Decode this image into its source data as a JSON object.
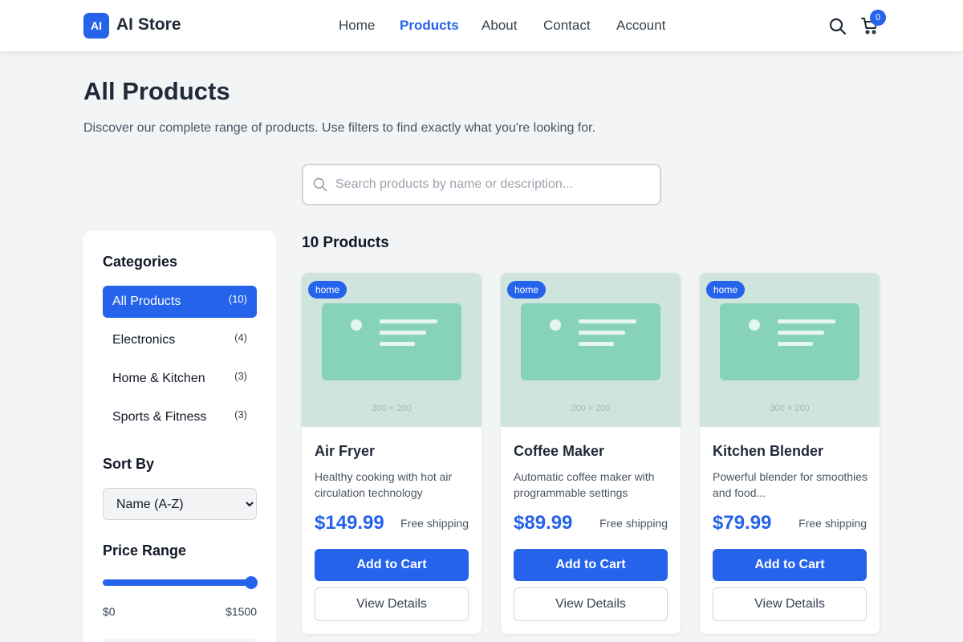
{
  "brand": {
    "logo_mark": "AI",
    "name": "AI Store"
  },
  "nav": {
    "items": [
      {
        "label": "Home",
        "active": false
      },
      {
        "label": "Products",
        "active": true
      },
      {
        "label": "About",
        "active": false
      },
      {
        "label": "Contact",
        "active": false
      },
      {
        "label": "Account",
        "active": false
      }
    ]
  },
  "header_icons": {
    "search": "search-icon",
    "cart": "cart-icon",
    "cart_count": "0"
  },
  "page": {
    "title": "All Products",
    "subtitle": "Discover our complete range of products. Use filters to find exactly what you're looking for."
  },
  "search": {
    "placeholder": "Search products by name or description...",
    "value": ""
  },
  "sidebar": {
    "categories_heading": "Categories",
    "categories": [
      {
        "label": "All Products",
        "count": "(10)",
        "active": true
      },
      {
        "label": "Electronics",
        "count": "(4)",
        "active": false
      },
      {
        "label": "Home & Kitchen",
        "count": "(3)",
        "active": false
      },
      {
        "label": "Sports & Fitness",
        "count": "(3)",
        "active": false
      }
    ],
    "sort_heading": "Sort By",
    "sort_selected": "Name (A-Z)",
    "price_heading": "Price Range",
    "price_min": "$0",
    "price_max": "$1500",
    "price_level_fraction": 1.0
  },
  "results": {
    "count_label": "10 Products",
    "products": [
      {
        "tag": "home",
        "image_caption": "300 × 200",
        "name": "Air Fryer",
        "description": "Healthy cooking with hot air circulation technology",
        "price": "$149.99",
        "shipping": "Free shipping",
        "add_label": "Add to Cart",
        "view_label": "View Details"
      },
      {
        "tag": "home",
        "image_caption": "300 × 200",
        "name": "Coffee Maker",
        "description": "Automatic coffee maker with programmable settings",
        "price": "$89.99",
        "shipping": "Free shipping",
        "add_label": "Add to Cart",
        "view_label": "View Details"
      },
      {
        "tag": "home",
        "image_caption": "300 × 200",
        "name": "Kitchen Blender",
        "description": "Powerful blender for smoothies and food...",
        "price": "$79.99",
        "shipping": "Free shipping",
        "add_label": "Add to Cart",
        "view_label": "View Details"
      }
    ]
  },
  "colors": {
    "accent": "#2563eb",
    "background": "#f3f4f6",
    "image_bg": "#cfe4dc",
    "image_placeholder": "#86d3b8"
  }
}
